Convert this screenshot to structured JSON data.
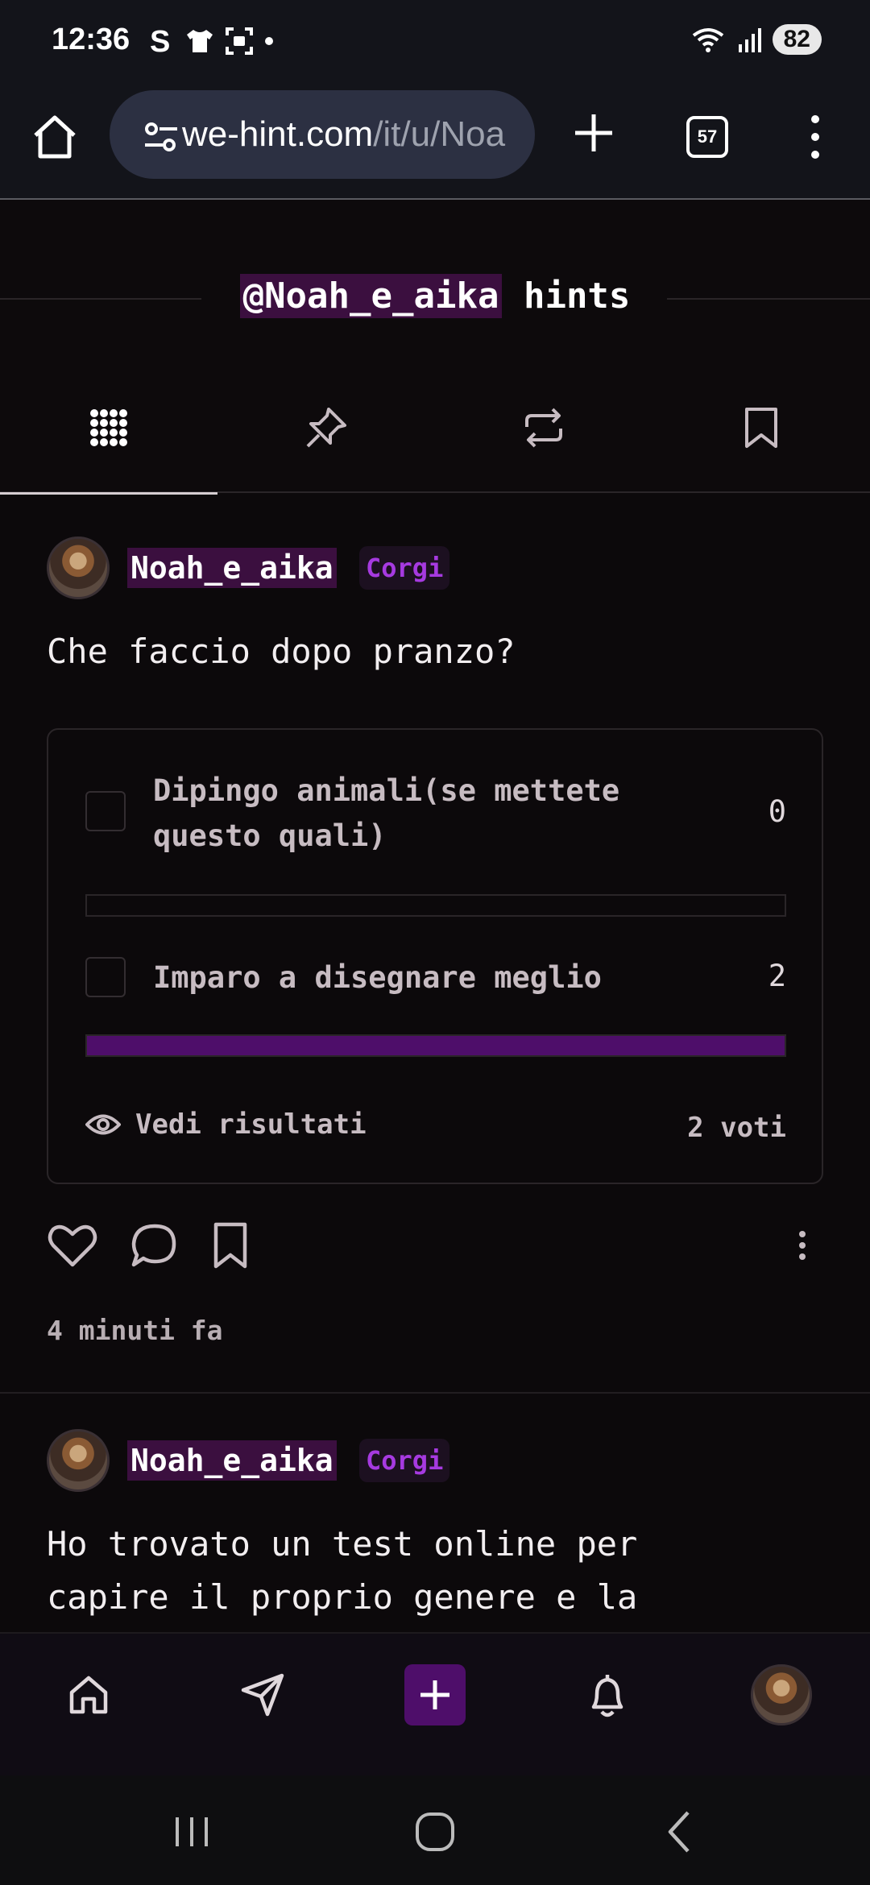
{
  "status_bar": {
    "time": "12:36",
    "battery": "82"
  },
  "browser": {
    "url_host": "we-hint.com",
    "url_path": "/it/u/Noa",
    "tab_count": "57"
  },
  "profile": {
    "handle": "@Noah_e_aika",
    "title_suffix": " hints"
  },
  "tabs": [
    {
      "name": "grid-icon",
      "active": true
    },
    {
      "name": "pin-icon",
      "active": false
    },
    {
      "name": "repost-icon",
      "active": false
    },
    {
      "name": "bookmark-icon",
      "active": false
    }
  ],
  "posts": [
    {
      "username": "Noah_e_aika",
      "badge": "Corgi",
      "text": "Che faccio dopo pranzo?",
      "poll": {
        "options": [
          {
            "label_line1": "Dipingo animali(se mettete",
            "label_line2": "questo quali)",
            "count": "0",
            "fraction": 0
          },
          {
            "label_line1": "Imparo a disegnare meglio",
            "label_line2": "",
            "count": "2",
            "fraction": 1
          }
        ],
        "see_results": "Vedi risultati",
        "votes": "2 voti"
      },
      "timestamp": "4 minuti fa"
    },
    {
      "username": "Noah_e_aika",
      "badge": "Corgi",
      "text_line1": "Ho trovato un test online per",
      "text_line2": "capire il proprio genere e la"
    }
  ],
  "colors": {
    "accent": "#4e0e6a",
    "badge_text": "#a63ae0",
    "handle_bg": "#3b0f3f",
    "background": "#0c090b"
  }
}
